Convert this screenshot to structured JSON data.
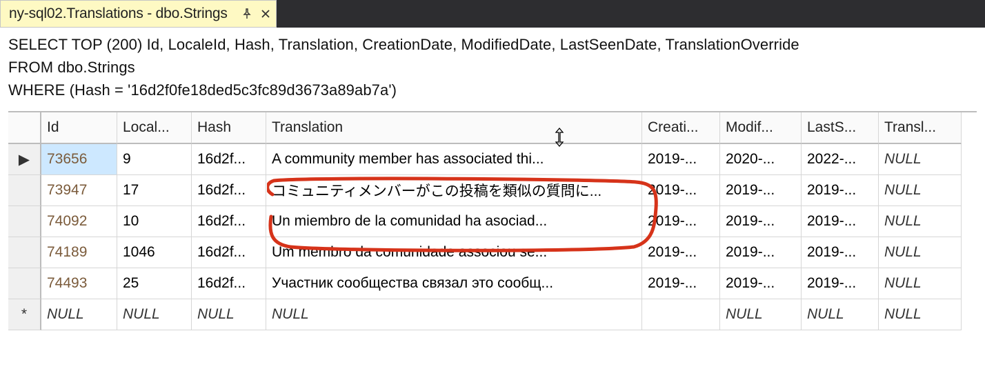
{
  "tab": {
    "title": "ny-sql02.Translations - dbo.Strings"
  },
  "sql": {
    "line1": "SELECT TOP (200) Id, LocaleId, Hash, Translation, CreationDate, ModifiedDate, LastSeenDate, TranslationOverride",
    "line2": "FROM   dbo.Strings",
    "line3": "WHERE (Hash = '16d2f0fe18ded5c3fc89d3673a89ab7a')"
  },
  "headers": {
    "id": "Id",
    "localeId": "Local...",
    "hash": "Hash",
    "translation": "Translation",
    "creationDate": "Creati...",
    "modifiedDate": "Modif...",
    "lastSeenDate": "LastS...",
    "translationOverride": "Transl..."
  },
  "rows": [
    {
      "id": "73656",
      "locale": "9",
      "hash": "16d2f...",
      "translation": "A community member has associated thi...",
      "creation": "2019-...",
      "modified": "2020-...",
      "lastseen": "2022-...",
      "override": "NULL"
    },
    {
      "id": "73947",
      "locale": "17",
      "hash": "16d2f...",
      "translation": "コミュニティメンバーがこの投稿を類似の質問に...",
      "creation": "2019-...",
      "modified": "2019-...",
      "lastseen": "2019-...",
      "override": "NULL"
    },
    {
      "id": "74092",
      "locale": "10",
      "hash": "16d2f...",
      "translation": "Un miembro de la comunidad ha asociad...",
      "creation": "2019-...",
      "modified": "2019-...",
      "lastseen": "2019-...",
      "override": "NULL"
    },
    {
      "id": "74189",
      "locale": "1046",
      "hash": "16d2f...",
      "translation": "Um membro da comunidade associou se...",
      "creation": "2019-...",
      "modified": "2019-...",
      "lastseen": "2019-...",
      "override": "NULL"
    },
    {
      "id": "74493",
      "locale": "25",
      "hash": "16d2f...",
      "translation": "Участник сообщества связал это сообщ...",
      "creation": "2019-...",
      "modified": "2019-...",
      "lastseen": "2019-...",
      "override": "NULL"
    }
  ],
  "newRow": {
    "id": "NULL",
    "locale": "NULL",
    "hash": "NULL",
    "translation": "NULL",
    "creation": "",
    "modified": "NULL",
    "lastseen": "NULL",
    "override": "NULL"
  },
  "glyphs": {
    "currentRow": "▶",
    "newRow": "*"
  }
}
